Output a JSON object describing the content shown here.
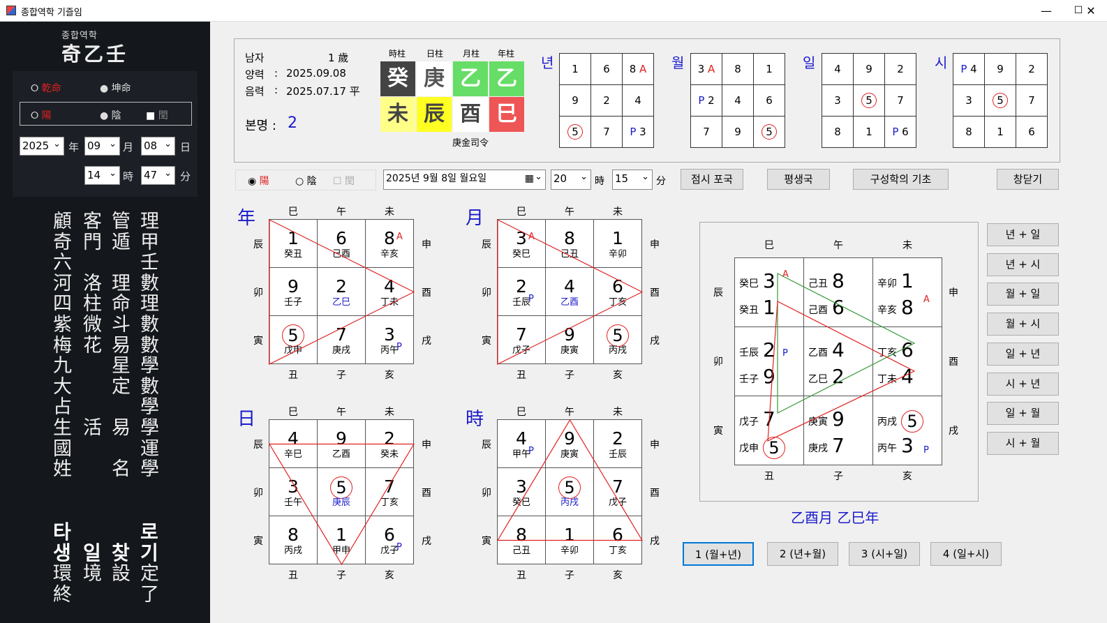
{
  "window": {
    "title": "종합역학 기즐임",
    "min": "—",
    "max": "☐",
    "close": "✕"
  },
  "sidebar": {
    "logo_small": "종합역학",
    "logo_big": "奇乙壬",
    "gender_m": "乾命",
    "gender_f": "坤命",
    "yang": "陽",
    "yin": "陰",
    "leap": "閏",
    "year": "2025",
    "year_lbl": "年",
    "month": "09",
    "month_lbl": "月",
    "day": "08",
    "day_lbl": "日",
    "hour": "14",
    "hour_lbl": "時",
    "minute": "47",
    "minute_lbl": "分",
    "menu_cols": [
      [
        "顧",
        "奇",
        "六",
        "河",
        "四",
        "紫",
        "梅",
        "九",
        "大",
        "占",
        "生",
        "國",
        "姓"
      ],
      [
        "客",
        "門",
        "",
        "洛",
        "柱",
        "微",
        "花",
        "",
        "",
        "",
        "活",
        "",
        ""
      ],
      [
        "管",
        "遁",
        "",
        "理",
        "命",
        "斗",
        "易",
        "星",
        "定",
        "",
        "易",
        "",
        "名"
      ],
      [
        "理",
        "甲",
        "壬",
        "數",
        "理",
        "數",
        "數",
        "學",
        "數",
        "學",
        "學",
        "運",
        "學"
      ]
    ],
    "bottom": {
      "c1": [
        "타",
        "생",
        "環",
        "終"
      ],
      "c2": [
        "",
        "일",
        "境",
        ""
      ],
      "c3": [
        "",
        "찾",
        "設",
        ""
      ],
      "c4": [
        "로",
        "기",
        "定",
        "了"
      ]
    }
  },
  "info": {
    "gender": "남자",
    "age": "1 歲",
    "solar_lbl": "양력",
    "solar": "2025.09.08",
    "colon": ":",
    "lunar_lbl": "음력",
    "lunar": "2025.07.17 平",
    "bonmyeong_lbl": "본명 :",
    "bonmyeong": "2",
    "pillar_headers": [
      "時柱",
      "日柱",
      "月柱",
      "年柱"
    ],
    "stems": [
      "癸",
      "庚",
      "乙",
      "乙"
    ],
    "branches": [
      "未",
      "辰",
      "酉",
      "巳"
    ],
    "saryeong": "庚金司令",
    "grid_labels": {
      "year": "년",
      "month": "월",
      "day": "일",
      "hour": "시"
    },
    "mini_year": [
      [
        "1",
        "6",
        "8 A"
      ],
      [
        "9",
        "2",
        "4"
      ],
      [
        "⑤",
        "7",
        "P 3"
      ]
    ],
    "mini_month": [
      [
        "3 A",
        "8",
        "1"
      ],
      [
        "P 2",
        "4",
        "6"
      ],
      [
        "7",
        "9",
        "⑤"
      ]
    ],
    "mini_day": [
      [
        "4",
        "9",
        "2"
      ],
      [
        "3",
        "⑤",
        "7"
      ],
      [
        "8",
        "1",
        "P 6"
      ]
    ],
    "mini_hour": [
      [
        "P 4",
        "9",
        "2"
      ],
      [
        "3",
        "⑤",
        "7"
      ],
      [
        "8",
        "1",
        "6"
      ]
    ]
  },
  "controls": {
    "yang": "陽",
    "yin": "陰",
    "leap": "閏",
    "date": "2025년   9월   8일 월요일",
    "hour": "20",
    "hour_lbl": "時",
    "minute": "15",
    "minute_lbl": "分",
    "btn1": "점시 포국",
    "btn2": "평생국",
    "btn3": "구성학의 기초",
    "btn4": "창닫기"
  },
  "edges": {
    "top": [
      "巳",
      "午",
      "未"
    ],
    "left": [
      "辰",
      "卯",
      "寅"
    ],
    "right": [
      "申",
      "酉",
      "戌"
    ],
    "bottom": [
      "丑",
      "子",
      "亥"
    ]
  },
  "grids": {
    "year": {
      "label": "年",
      "cells": [
        [
          "1",
          "癸丑"
        ],
        [
          "6",
          "己酉"
        ],
        [
          "8",
          "辛亥"
        ],
        [
          "9",
          "壬子"
        ],
        [
          "2",
          "乙巳"
        ],
        [
          "4",
          "丁未"
        ],
        [
          "5",
          "戊申"
        ],
        [
          "7",
          "庚戌"
        ],
        [
          "3",
          "丙午"
        ]
      ]
    },
    "month": {
      "label": "月",
      "cells": [
        [
          "3",
          "癸巳"
        ],
        [
          "8",
          "己丑"
        ],
        [
          "1",
          "辛卯"
        ],
        [
          "2",
          "壬辰"
        ],
        [
          "4",
          "乙酉"
        ],
        [
          "6",
          "丁亥"
        ],
        [
          "7",
          "戊子"
        ],
        [
          "9",
          "庚寅"
        ],
        [
          "5",
          "丙戌"
        ]
      ]
    },
    "day": {
      "label": "日",
      "cells": [
        [
          "4",
          "辛巳"
        ],
        [
          "9",
          "乙酉"
        ],
        [
          "2",
          "癸未"
        ],
        [
          "3",
          "壬午"
        ],
        [
          "5",
          "庚辰"
        ],
        [
          "7",
          "丁亥"
        ],
        [
          "8",
          "丙戌"
        ],
        [
          "1",
          "甲申"
        ],
        [
          "6",
          "戊子"
        ]
      ]
    },
    "hour": {
      "label": "時",
      "cells": [
        [
          "4",
          "甲午"
        ],
        [
          "9",
          "庚寅"
        ],
        [
          "2",
          "壬辰"
        ],
        [
          "3",
          "癸巳"
        ],
        [
          "5",
          "丙戌"
        ],
        [
          "7",
          "戊子"
        ],
        [
          "8",
          "己丑"
        ],
        [
          "1",
          "辛卯"
        ],
        [
          "6",
          "丁亥"
        ]
      ]
    }
  },
  "big": {
    "cells": [
      [
        [
          "癸巳",
          "3"
        ],
        [
          "癸丑",
          "1"
        ]
      ],
      [
        [
          "己丑",
          "8"
        ],
        [
          "己酉",
          "6"
        ]
      ],
      [
        [
          "辛卯",
          "1"
        ],
        [
          "辛亥",
          "8"
        ]
      ],
      [
        [
          "壬辰",
          "2"
        ],
        [
          "壬子",
          "9"
        ]
      ],
      [
        [
          "乙酉",
          "4"
        ],
        [
          "乙巳",
          "2"
        ]
      ],
      [
        [
          "丁亥",
          "6"
        ],
        [
          "丁未",
          "4"
        ]
      ],
      [
        [
          "戊子",
          "7"
        ],
        [
          "戊申",
          "5"
        ]
      ],
      [
        [
          "庚寅",
          "9"
        ],
        [
          "庚戌",
          "7"
        ]
      ],
      [
        [
          "丙戌",
          "5"
        ],
        [
          "丙午",
          "3"
        ]
      ]
    ],
    "caption": "乙酉月  乙巳年"
  },
  "side_buttons": [
    "년 + 일",
    "년 + 시",
    "월 + 일",
    "월 + 시",
    "일 + 년",
    "시 + 년",
    "일 + 월",
    "시 + 월"
  ],
  "bottom_buttons": [
    "1 (월+년)",
    "2 (년+월)",
    "3 (시+일)",
    "4 (일+시)"
  ],
  "marks": {
    "A": "A",
    "P": "P"
  }
}
